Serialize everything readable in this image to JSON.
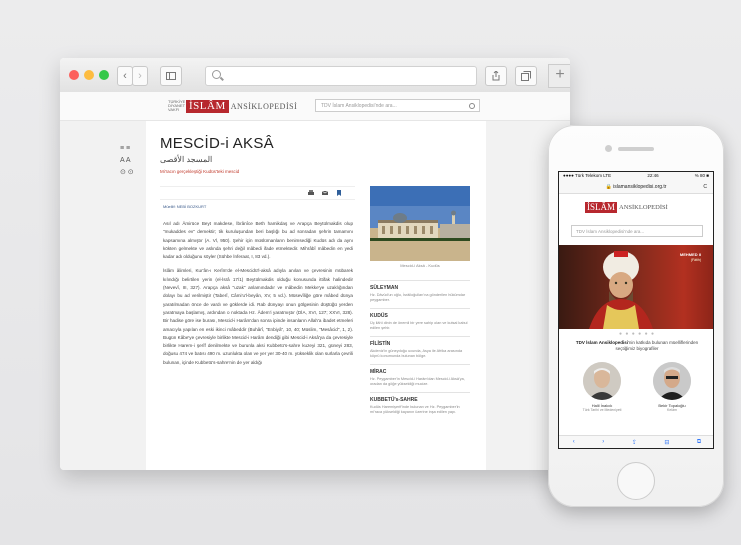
{
  "desktop": {
    "toolbar": {
      "back_label": "‹",
      "forward_label": "›",
      "tabs_label": "+"
    },
    "site": {
      "logo_small": "TÜRKİYE DİYANET VAKFI",
      "logo_box": "İSLÂM",
      "logo_rest": "ANSİKLOPEDİSİ",
      "search_placeholder": "TDV İslam Ansiklopedisi'nde ara..."
    },
    "side_tools": [
      "≡ ≡",
      "A A",
      "⊙ ⊙"
    ],
    "article": {
      "title": "MESCİD-i AKSÂ",
      "arabic": "المسجد الأقصى",
      "description": "Mi'racın gerçekleştiği Kudüs'teki mescid",
      "author": "Müellif: NEBİ BOZKURT",
      "paragraphs": [
        "Asıl adı Âmirüce Beyt makdese, İbrânîce Beth hamikdaş ve Arapça Beytülmakdis olup \"mukaddes ev\" demektir; tik kuruluşundan beri başlığı bu ad sonradan şehrin tamamını kapsamına almıştır (A. Vl, 950). Şehir için müslümanların benimsediği Kudüs adı da aynı kökten gelmekte ve aslında şehri değil mâbedi ifade etmektedir. Mihrâbî mâbedin en yedi kadar adı olduğunu söyler (Sühbe İnferaat, I, 83 vd.).",
        "İslâm âlimleri, Kur'ân-ı Kerîm'de el-Mescidü'l-aksâ adıyla anılan ve çevresinin mübarek kılındığı belirtilen yerin (el-İsrâ 17/1) Beytülmakdis olduğu konusunda ittifak halindedir (Nevevî, III, 327). Arapça aksâ \"uzak\" anlamındadır ve mâbedin Mekke'ye uzaklığından dolayı bu ad verilmiştir (Taberî, Câmi'u'l-beyân, XV, 5 vd.). Müsevîliğe göre mâbed dünya yaratılmadan önce de vardı ve göklerde idi. Rab dünyayı onun gölgesinin düştüğü yerden yaratmaya başlamış, ardından o noktada Hz. Âdem'i yaratmıştır (DİA, XVI, 127; XXVI, 328). Bir hadise göre ise burası, Mescid-i Harâm'dan sonra ipinde insanların Allah'a ibadet etmeleri amacıyla yapılan en eski ikinci mâbeddir (Buhârî, \"Enbiyâ\", 10, 40; Müslim, \"Mesâcid\", 1, 2). Bugün Kâbe'ye çevresiyle birlikte Mescid-i Harâm dendiği gibi Mescid-i Aksâ'ya da çevresiyle birlikte Harem-i şerîf denilmekte ve burunla aksi Kubbetü's-sahre kuzeyi 321, güneyi 283, doğusu 474 ve batısı 490 m. uzunlukta olan ve yer yer 30-40 m. yükseklik olan surlarla çevrili bulunan, içinde Kubbetü's-sahre'nin de yer aldığı"
      ],
      "photo_caption": "Mescid-i Aksâ - Kudüs",
      "related": [
        {
          "title": "SÜLEYMAN",
          "desc": "Hz. Dâvûd'un oğlu, İsrâiloğulları'na gönderilen hükümdar peygamber."
        },
        {
          "title": "KUDÜS",
          "desc": "Üç ilâhî dinin de önemli bir yere sahip olan ve kutsal kabul edilen şehir."
        },
        {
          "title": "FİLİSTİN",
          "desc": "Akdeniz'in güneydoğu ucunda, Asya ile Afrika arasında köprü konumunda bulunan bölge."
        },
        {
          "title": "MİRAC",
          "desc": "Hz. Peygamber'in Mescid-i Harâm'dan Mescid-i Aksâ'ya, oradan da göğe yükseldiği mucize."
        },
        {
          "title": "KUBBETÜ's-SAHRE",
          "desc": "Kudüs Haremişerif'inde bulunan ve Hz. Peygamber'in mi'raca yükseldiği kayanın üzerine inşa edilen yapı."
        }
      ]
    }
  },
  "mobile": {
    "status": {
      "carrier": "●●●● Türk Telekom  LTE",
      "time": "22:46",
      "battery": "% 80 ■"
    },
    "url": "🔒 islamansiklopedisi.org.tr",
    "reload": "C",
    "logo_box": "İSLÂM",
    "logo_rest": "ANSİKLOPEDİSİ",
    "search_placeholder": "TDV İslam Ansiklopedisi'nde ara...",
    "hero_badge": "MEHMED II",
    "hero_sub": "(Fâtih)",
    "pagination": "● ● ● ● ● ●",
    "tagline_bold": "TDV İslam Ansiklopedisi",
    "tagline_rest": "'nin katkıda bulunan müelliflerinden seçtiğimiz biyografiler",
    "people": [
      {
        "name": "Halil İnalcık",
        "role": "Türk Tarihi ve Medeniyeti"
      },
      {
        "name": "Bekir Topaloğlu",
        "role": "Kelâm"
      }
    ],
    "toolbar": [
      "‹",
      "›",
      "⇪",
      "⊟",
      "⧉"
    ]
  }
}
